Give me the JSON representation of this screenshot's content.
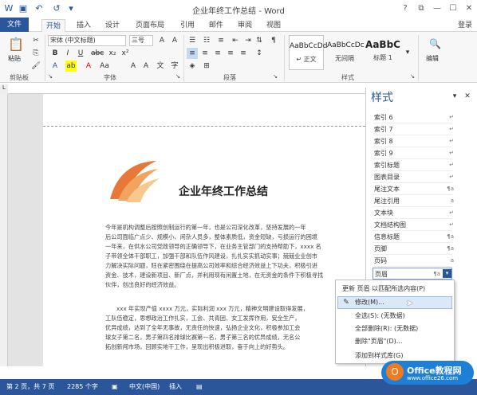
{
  "window": {
    "title": "企业年终工作总结 - Word",
    "login": "登录"
  },
  "tabs": [
    "文件",
    "开始",
    "插入",
    "设计",
    "页面布局",
    "引用",
    "邮件",
    "审阅",
    "视图"
  ],
  "ribbon": {
    "paste": "粘贴",
    "font_name": "宋体 (中文标题)",
    "font_size": "三号",
    "style_gallery": [
      {
        "sample": "AaBbCcDd",
        "name": "↵ 正文"
      },
      {
        "sample": "AaBbCcDc",
        "name": "无间隔"
      },
      {
        "sample": "AaBbC",
        "name": "标题 1"
      }
    ],
    "edit": "编辑",
    "groups": {
      "clipboard": "剪贴板",
      "font": "字体",
      "paragraph": "段落",
      "styles": "样式"
    }
  },
  "document": {
    "title": "企业年终工作总结",
    "paragraphs": [
      "今年是机构调整后按照创制运行的第一年，也是公司深化改革，坚持发展的一年",
      "后公司面临广点少、规模小、闲杂人员多，整体素质低，资金短缺，亏损运行的困境",
      "一年来，在供水公司党政领导的正确领导下，在业务主管部门的支持帮助下，xxxx 名",
      "子带领全体干部职工，加强干部和队伍作风建设，扎扎实实抓动实事；兢兢业业创市",
      "力解决实际问题，旺在紧密围绕在提高公司效率和综合经济效益上下功夫，积极引进",
      "资金、技术，建设新项目、新厂点，并利用现有闲置土地，在无资金的条件下积极寻找",
      "伙伴，创出良好的经济效益。",
      "xxx 年实现产值 xxxx 万元，实际利润 xxx 万元，精神文明建设取得发展，",
      "工队伍稳定，思想政治工作扎实，工会、共青团、女工发挥作用，安全生产，",
      "优异成绩，达到了全年无事故，无责任的快速，弘扬企业文化，积极参加工会",
      "球女子第二名，男子第四名排球比赛第一名，男子第三名的优异成绩，无名公",
      "拓创新闯市场，回顾实地干工作，呈现出积极进取，奋于向上的好势头。"
    ]
  },
  "styles_pane": {
    "title": "样式",
    "items": [
      "索引 6",
      "索引 7",
      "索引 8",
      "索引 9",
      "索引标题",
      "图表目录",
      "尾注文本",
      "尾注引用",
      "文本块",
      "文档结构图",
      "信息标题",
      "页脚",
      "页码",
      "页眉"
    ],
    "icons": [
      "↵",
      "↵",
      "↵",
      "↵",
      "↵",
      "↵",
      "¶a",
      "a",
      "↵",
      "↵",
      "¶a",
      "¶a",
      "a",
      "¶a"
    ],
    "selected": "页眉"
  },
  "context_menu": {
    "items": [
      "更新 页眉 以匹配所选内容(P)",
      "修改(M)...",
      "全选(S): (无数据)",
      "全部删除(R): (无数据)",
      "删除\"页眉\"(D)...",
      "添加到样式库(G)"
    ]
  },
  "status": {
    "page": "第 2 页，共 7 页",
    "words": "2285 个字",
    "lang": "中文(中国)",
    "mode": "插入"
  },
  "watermark": {
    "brand": "Office教程网",
    "url": "www.office26.com"
  }
}
